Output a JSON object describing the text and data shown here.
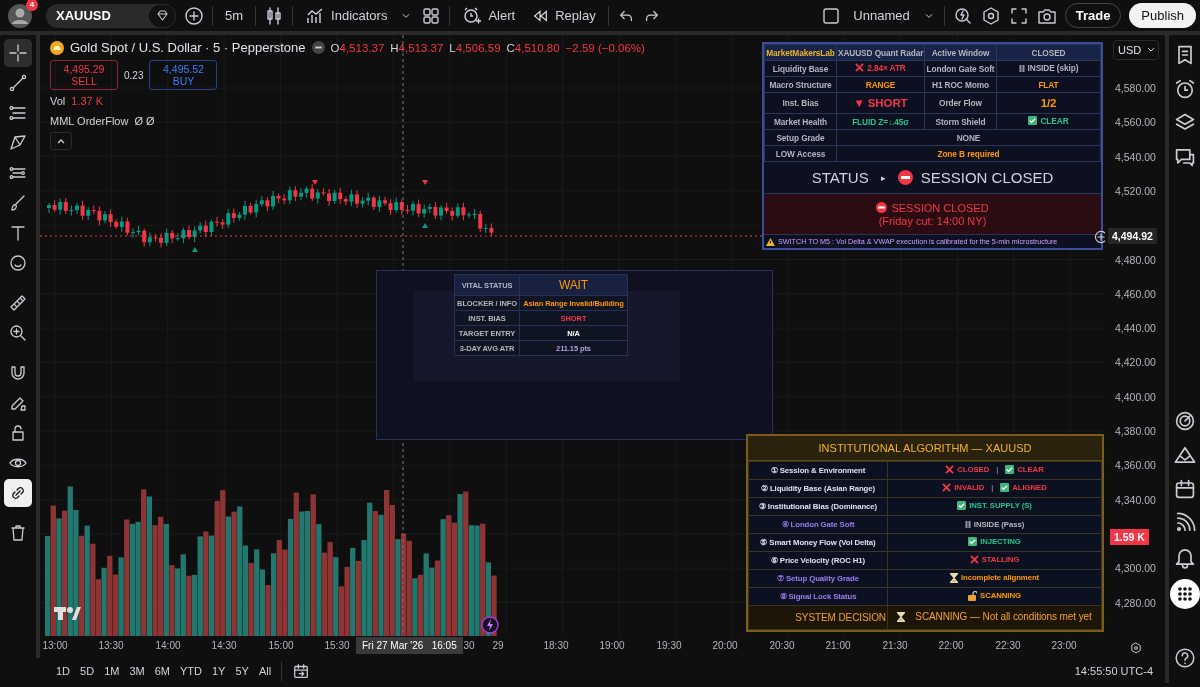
{
  "top_bar": {
    "notification_count": "4",
    "symbol": "XAUUSD",
    "interval": "5m",
    "indicators": "Indicators",
    "alert": "Alert",
    "replay": "Replay",
    "layout_name": "Unnamed",
    "trade": "Trade",
    "publish": "Publish"
  },
  "left_toolbar": [
    {
      "kind": "crosshair",
      "selected": true
    },
    {
      "kind": "trend-line",
      "selected": false
    },
    {
      "kind": "channel",
      "selected": false
    },
    {
      "kind": "pattern",
      "selected": false
    },
    {
      "kind": "forecast",
      "selected": false
    },
    {
      "kind": "brush",
      "selected": false
    },
    {
      "kind": "text",
      "selected": false
    },
    {
      "kind": "emoji",
      "selected": false
    },
    {
      "kind": "ruler",
      "selected": false
    },
    {
      "kind": "zoom",
      "selected": false
    },
    {
      "kind": "magnet",
      "selected": false
    },
    {
      "kind": "pencil",
      "selected": false
    },
    {
      "kind": "lock",
      "selected": false
    },
    {
      "kind": "eye",
      "selected": false
    },
    {
      "kind": "link",
      "selected": true
    },
    {
      "kind": "trash",
      "selected": false
    }
  ],
  "legend": {
    "title": "Gold Spot / U.S. Dollar · 5 · Pepperstone",
    "ohlc": [
      {
        "label": "O",
        "value": "4,513.37"
      },
      {
        "label": "H",
        "value": "4,513.37"
      },
      {
        "label": "L",
        "value": "4,506.59"
      },
      {
        "label": "C",
        "value": "4,510.80"
      }
    ],
    "change": "−2.59 (−0.06%)",
    "sell": {
      "price": "4,495.29",
      "label": "SELL"
    },
    "spread": "0.23",
    "buy": {
      "price": "4,495.52",
      "label": "BUY"
    },
    "volume": {
      "label": "Vol",
      "value": "1.37 K"
    },
    "indicator": {
      "name": "MML OrderFlow",
      "values": "Ø Ø"
    }
  },
  "radar": {
    "rows": [
      {
        "kind": "header",
        "cells": [
          {
            "kind": "text",
            "text": "MarketMakersLab",
            "color": "#f0b429"
          },
          {
            "kind": "text",
            "text": "XAUUSD Quant Radar",
            "color": "#b2b5be"
          },
          {
            "kind": "text",
            "text": "Active Window",
            "color": "#b2b5be"
          },
          {
            "kind": "text",
            "text": "CLOSED",
            "color": "#b2b5be"
          }
        ]
      },
      {
        "kind": "pair",
        "cells": [
          {
            "kind": "text",
            "text": "Liquidity Base",
            "color": "#b2b5be"
          },
          {
            "kind": "cross",
            "text": "2.84× ATR",
            "color": "#f23645"
          },
          {
            "kind": "text",
            "text": "London Gate Soft",
            "color": "#b2b5be"
          },
          {
            "kind": "pause",
            "text": "INSIDE (skip)",
            "color": "#b2b5be"
          }
        ]
      },
      {
        "kind": "pair",
        "cells": [
          {
            "kind": "text",
            "text": "Macro Structure",
            "color": "#b2b5be"
          },
          {
            "kind": "text",
            "text": "RANGE",
            "color": "#ff9800"
          },
          {
            "kind": "text",
            "text": "H1 ROC Momo",
            "color": "#b2b5be"
          },
          {
            "kind": "text",
            "text": "FLAT",
            "color": "#ff9800"
          }
        ]
      },
      {
        "kind": "large-pair",
        "cells": [
          {
            "kind": "text",
            "text": "Inst. Bias",
            "color": "#b2b5be"
          },
          {
            "kind": "text",
            "text": "▼ SHORT",
            "color": "#f23645"
          },
          {
            "kind": "text",
            "text": "Order Flow",
            "color": "#b2b5be"
          },
          {
            "kind": "text",
            "text": "1/2",
            "color": "#ff9800"
          }
        ]
      },
      {
        "kind": "pair",
        "cells": [
          {
            "kind": "text",
            "text": "Market Health",
            "color": "#b2b5be"
          },
          {
            "kind": "text",
            "text": "FLUID  Z=↓.45σ",
            "color": "#22c58b"
          },
          {
            "kind": "text",
            "text": "Storm Shield",
            "color": "#b2b5be"
          },
          {
            "kind": "check",
            "text": "CLEAR",
            "color": "#22c58b"
          }
        ]
      },
      {
        "kind": "wide",
        "cells": [
          {
            "kind": "text",
            "text": "Setup Grade",
            "color": "#b2b5be"
          },
          {
            "kind": "text",
            "text": "NONE",
            "color": "#b2b5be",
            "colspan": 3
          }
        ]
      },
      {
        "kind": "wide",
        "cells": [
          {
            "kind": "text",
            "text": "LOW Access",
            "color": "#b2b5be"
          },
          {
            "kind": "text",
            "text": "Zone B required",
            "color": "#ff9800",
            "colspan": 3
          }
        ]
      }
    ],
    "status": {
      "label": "STATUS",
      "arrow": "▸",
      "value": "SESSION CLOSED"
    },
    "alert": {
      "title": "SESSION CLOSED",
      "detail": "(Friday cut: 14:00 NY)"
    },
    "warning": "SWITCH TO M5 : Vol Delta & VWAP execution is calibrated for the 5-min microstructure"
  },
  "vital": {
    "rows": [
      {
        "kind": "header",
        "label": "VITAL STATUS",
        "value": "WAIT",
        "color": "#ff9800"
      },
      {
        "kind": "row",
        "label": "BLOCKER / INFO",
        "value": "Asian Range Invalid/Building",
        "color": "#ff9800"
      },
      {
        "kind": "row",
        "label": "INST. BIAS",
        "value": "SHORT",
        "color": "#f23645"
      },
      {
        "kind": "row",
        "label": "TARGET ENTRY",
        "value": "N/A",
        "color": "#ffffff"
      },
      {
        "kind": "row",
        "label": "3-DAY AVG ATR",
        "value": "211.15 pts",
        "color": "#b39ddb"
      }
    ]
  },
  "algo": {
    "title": "INSTITUTIONAL ALGORITHM — XAUUSD",
    "rows": [
      {
        "label": "① Session & Environment",
        "color": "#e0e3eb",
        "parts": [
          {
            "kind": "cross",
            "text": "CLOSED",
            "color": "#f23645"
          },
          {
            "kind": "check",
            "text": "CLEAR",
            "color": "#f23645"
          }
        ],
        "separator": "|"
      },
      {
        "label": "② Liquidity Base (Asian Range)",
        "color": "#e0e3eb",
        "parts": [
          {
            "kind": "cross",
            "text": "INVALID",
            "color": "#f23645"
          },
          {
            "kind": "check",
            "text": "ALIGNED",
            "color": "#f23645"
          }
        ],
        "separator": "|"
      },
      {
        "label": "③ Institutional Bias (Dominance)",
        "color": "#e0e3eb",
        "parts": [
          {
            "kind": "check",
            "text": "INST. SUPPLY (S)",
            "color": "#22c58b"
          }
        ]
      },
      {
        "label": "④ London Gate Soft",
        "color": "#9c7cf0",
        "parts": [
          {
            "kind": "pause",
            "text": "INSIDE (Pass)",
            "color": "#b2b5be"
          }
        ]
      },
      {
        "label": "⑤ Smart Money Flow (Vol Delta)",
        "color": "#e0e3eb",
        "parts": [
          {
            "kind": "check",
            "text": "INJECTING",
            "color": "#22c58b"
          }
        ]
      },
      {
        "label": "⑥ Price Velocity (ROC H1)",
        "color": "#e0e3eb",
        "parts": [
          {
            "kind": "cross",
            "text": "STALLING",
            "color": "#f23645"
          }
        ]
      },
      {
        "label": "⑦ Setup Quality Grade",
        "color": "#9c7cf0",
        "parts": [
          {
            "kind": "hourglass",
            "text": "Incomplete alignment",
            "color": "#ff9800"
          }
        ]
      },
      {
        "label": "⑧ Signal Lock Status",
        "color": "#9c7cf0",
        "parts": [
          {
            "kind": "lock",
            "text": "SCANNING",
            "color": "#ff9800"
          }
        ]
      }
    ],
    "decision": {
      "label": "SYSTEM DECISION",
      "kind": "hourglass",
      "text": "SCANNING — Not all conditions met yet"
    }
  },
  "price_axis": {
    "currency": "USD",
    "labels": [
      "4,580.00",
      "4,560.00",
      "4,540.00",
      "4,520.00",
      "4,480.00",
      "4,460.00",
      "4,440.00",
      "4,420.00",
      "4,400.00",
      "4,380.00",
      "4,360.00",
      "4,340.00",
      "4,300.00",
      "4,280.00"
    ],
    "last_price": "4,494.92",
    "volume_tag": "1.59 K"
  },
  "time_axis": {
    "labels": [
      "13:00",
      "13:30",
      "14:00",
      "14:30",
      "15:00",
      "15:30",
      "30",
      "29",
      "18:30",
      "19:00",
      "19:30",
      "20:00",
      "20:30",
      "21:00",
      "21:30",
      "22:00",
      "22:30",
      "23:00"
    ],
    "crosshair": "Fri 27 Mar '26   16:05"
  },
  "bottom_bar": {
    "ranges": [
      "1D",
      "5D",
      "1M",
      "3M",
      "6M",
      "YTD",
      "1Y",
      "5Y",
      "All"
    ],
    "clock": "14:55:50 UTC-4"
  }
}
